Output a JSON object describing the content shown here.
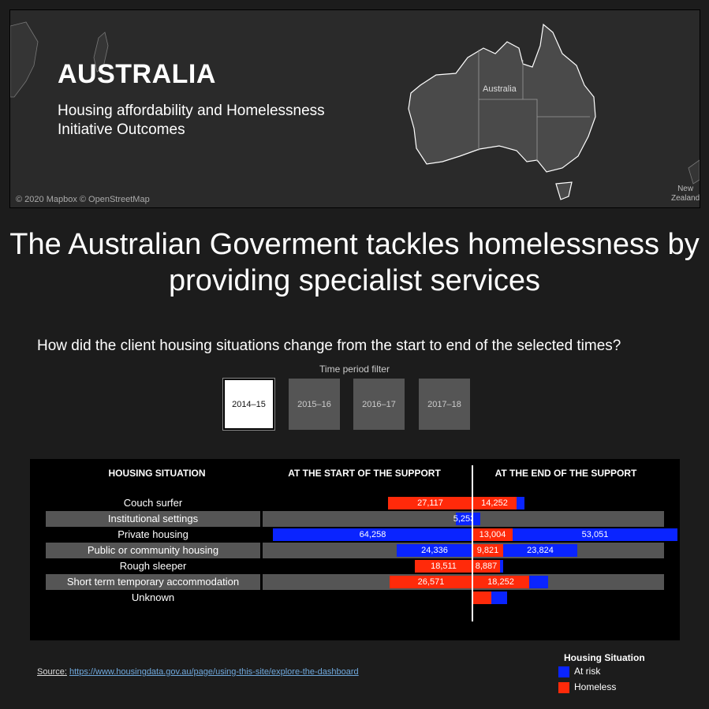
{
  "map": {
    "title": "AUSTRALIA",
    "subtitle": "Housing affordability and Homelessness Initiative Outcomes",
    "credit": "© 2020 Mapbox © OpenStreetMap",
    "au_label": "Australia",
    "nz_label_1": "New",
    "nz_label_2": "Zealand"
  },
  "headline": "The Australian Goverment tackles homelessness by providing specialist services",
  "question": "How did the client housing situations change from the start to end of the selected times?",
  "filter": {
    "label": "Time period filter",
    "options": [
      "2014–15",
      "2015–16",
      "2016–17",
      "2017–18"
    ],
    "selected": "2014–15"
  },
  "table": {
    "headers": {
      "situation": "HOUSING SITUATION",
      "start": "AT THE START OF THE SUPPORT",
      "end": "AT THE END OF THE SUPPORT"
    }
  },
  "colors": {
    "at_risk": "#0a24ff",
    "homeless": "#ff2a0a"
  },
  "chart_data": {
    "type": "bar",
    "categories": [
      "Couch surfer",
      "Institutional settings",
      "Private housing",
      "Public or community housing",
      "Rough sleeper",
      "Short term temporary accommodation",
      "Unknown"
    ],
    "series": [
      {
        "name": "Start – Homeless",
        "values": [
          27117,
          0,
          0,
          0,
          18511,
          26571,
          0
        ]
      },
      {
        "name": "Start – At risk",
        "values": [
          0,
          5253,
          64258,
          24336,
          0,
          0,
          0
        ]
      },
      {
        "name": "End – Homeless",
        "values": [
          14252,
          0,
          13004,
          9821,
          8887,
          18252,
          6000
        ]
      },
      {
        "name": "End – At risk",
        "values": [
          2500,
          2500,
          53051,
          23824,
          1000,
          6000,
          5000
        ]
      }
    ],
    "labels": {
      "start": [
        "27,117",
        "5,253",
        "64,258",
        "24,336",
        "18,511",
        "26,571",
        ""
      ],
      "end_homeless": [
        "14,252",
        "",
        "13,004",
        "9,821",
        "8,887",
        "18,252",
        ""
      ],
      "end_at_risk": [
        "",
        "",
        "53,051",
        "23,824",
        "",
        "",
        ""
      ]
    }
  },
  "legend": {
    "title": "Housing Situation",
    "items": [
      {
        "label": "At risk",
        "color": "#0a24ff"
      },
      {
        "label": "Homeless",
        "color": "#ff2a0a"
      }
    ]
  },
  "source": {
    "label": "Source:",
    "url": "https://www.housingdata.gov.au/page/using-this-site/explore-the-dashboard"
  }
}
